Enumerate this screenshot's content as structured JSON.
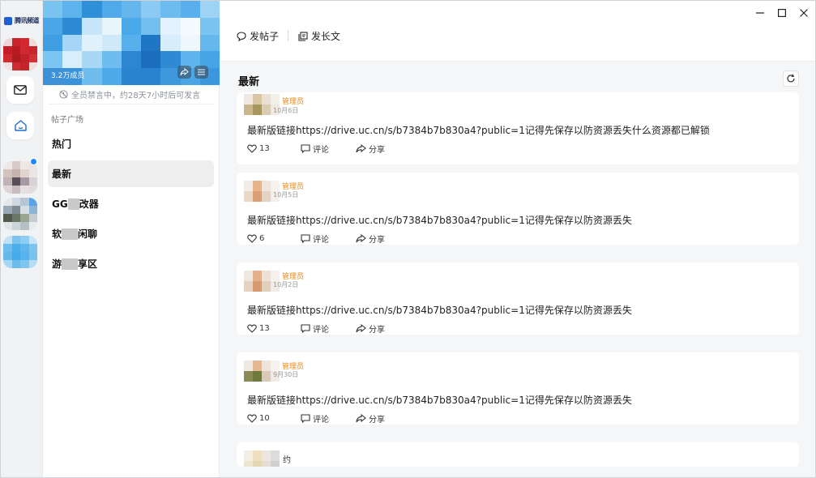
{
  "app": {
    "logo_text": "腾讯频道"
  },
  "window_controls": {
    "minimize": "minimize",
    "maximize": "maximize",
    "close": "close"
  },
  "channel": {
    "member_count": "3.2万成员",
    "mute_notice": "全员禁言中，约28天7小时后可发言",
    "section_title": "帖子广场",
    "nav": [
      {
        "label": "热门"
      },
      {
        "label": "最新"
      },
      {
        "label_prefix": "GG",
        "label_suffix": "改器"
      },
      {
        "label_prefix": "软",
        "label_suffix": "闲聊"
      },
      {
        "label_prefix": "游",
        "label_suffix": "享区"
      }
    ],
    "active_nav": "最新"
  },
  "toolbar": {
    "post_label": "发帖子",
    "article_label": "发长文"
  },
  "feed": {
    "sort_title": "最新",
    "posts": [
      {
        "role": "管理员",
        "date": "10月6日",
        "content": "最新版链接https://drive.uc.cn/s/b7384b7b830a4?public=1记得先保存以防资源丢失什么资源都已解锁",
        "likes": "13",
        "comment_label": "评论",
        "share_label": "分享"
      },
      {
        "role": "管理员",
        "date": "10月5日",
        "content": "最新版链接https://drive.uc.cn/s/b7384b7b830a4?public=1记得先保存以防资源丢失",
        "likes": "6",
        "comment_label": "评论",
        "share_label": "分享"
      },
      {
        "role": "管理员",
        "date": "10月2日",
        "content": "最新版链接https://drive.uc.cn/s/b7384b7b830a4?public=1记得先保存以防资源丢失",
        "likes": "13",
        "comment_label": "评论",
        "share_label": "分享"
      },
      {
        "role": "管理员",
        "date": "9月30日",
        "content": "最新版链接https://drive.uc.cn/s/b7384b7b830a4?public=1记得先保存以防资源丢失",
        "likes": "10",
        "comment_label": "评论",
        "share_label": "分享"
      }
    ],
    "partial_post_fragment": "约"
  },
  "colors": {
    "accent_blue": "#1e88ff",
    "role_orange": "#e88a1a",
    "logo_blue": "#1f5fd6"
  }
}
